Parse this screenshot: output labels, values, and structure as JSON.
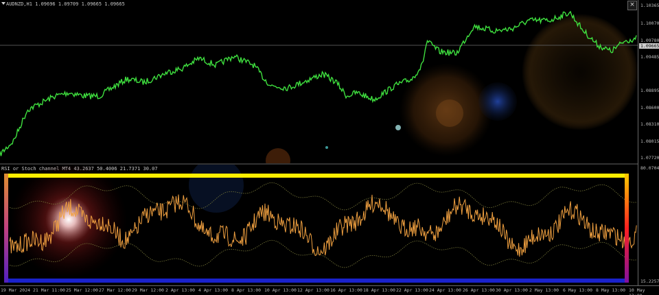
{
  "chart": {
    "symbol_line": "AUDNZD,H1  1.09696 1.09709 1.09665 1.09665",
    "indicator_line": "RSI or Stoch channel MT4 43.2637 50.4006 21.7371 30.07",
    "current_price_tag": "1.09665",
    "indicator_tag": "80.0704",
    "indicator_bottom": "15.2257",
    "close_glyph": "×"
  },
  "price_axis": [
    "1.10365",
    "1.10070",
    "1.09780",
    "1.09485",
    "1.08895",
    "1.08600",
    "1.08310",
    "1.08015",
    "1.07720"
  ],
  "time_axis": [
    "19 Mar 2024",
    "21 Mar 11:00",
    "25 Mar 12:00",
    "27 Mar 12:00",
    "29 Mar 12:00",
    "2 Apr 13:00",
    "4 Apr 13:00",
    "8 Apr 13:00",
    "10 Apr 13:00",
    "12 Apr 13:00",
    "16 Apr 13:00",
    "18 Apr 13:00",
    "22 Apr 13:00",
    "24 Apr 13:00",
    "26 Apr 13:00",
    "30 Apr 13:00",
    "2 May 13:00",
    "6 May 13:00",
    "8 May 13:00",
    "10 May 13:00"
  ],
  "colors": {
    "price_line": "#3fe03f",
    "osc_line": "#f0a040",
    "channel": "#7a7a3a",
    "frame_top": "#ffee00",
    "frame_bottom": "#1a22cc",
    "frame_left": "#a020c0",
    "frame_right": "#ff3300"
  },
  "icons": {
    "menu": "dropdown-triangle-icon",
    "close": "close-icon"
  }
}
